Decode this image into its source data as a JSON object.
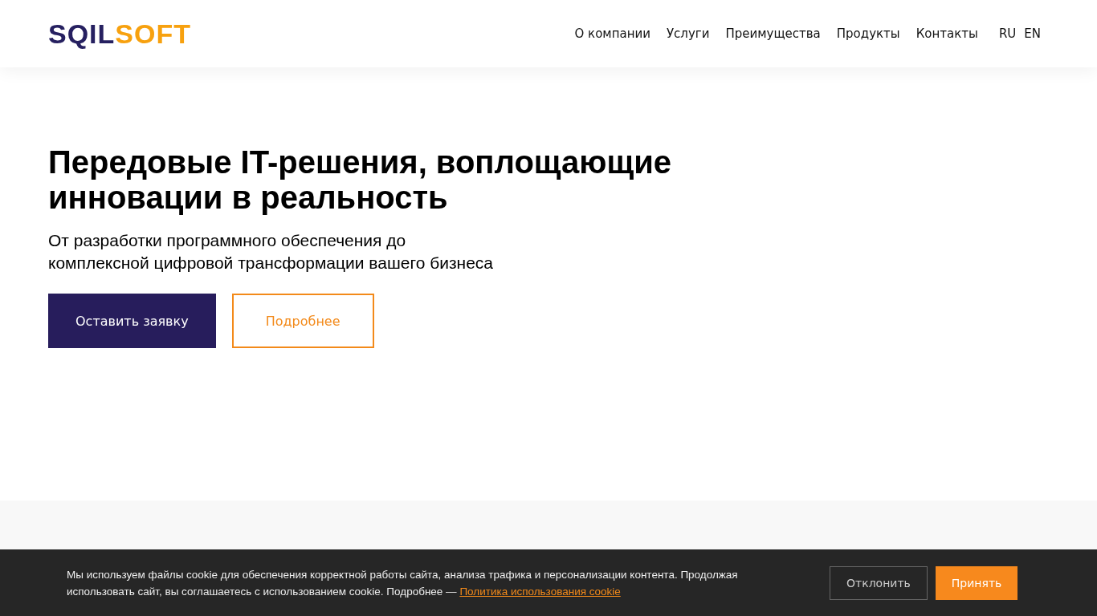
{
  "header": {
    "logo": {
      "dark_part": "SQIL",
      "accent_part": "SOFT"
    },
    "nav": [
      {
        "label": "О компании"
      },
      {
        "label": "Услуги"
      },
      {
        "label": "Преимущества"
      },
      {
        "label": "Продукты"
      },
      {
        "label": "Контакты"
      }
    ],
    "languages": [
      {
        "label": "RU"
      },
      {
        "label": "EN"
      }
    ]
  },
  "hero": {
    "title": "Передовые IT-решения, воплощающие инновации в реальность",
    "subtitle": "От разработки программного обеспечения до комплексной цифровой трансформации вашего бизнеса",
    "buttons": [
      {
        "label": "Оставить заявку",
        "kind": "primary"
      },
      {
        "label": "Подробнее",
        "kind": "outline"
      }
    ]
  },
  "cookie_banner": {
    "text": "Мы используем файлы cookie для обеспечения корректной работы сайта, анализа трафика и персонализации контента. Продолжая использовать сайт, вы соглашаетесь с использованием cookie. Подробнее —",
    "link": "Политика использования cookie",
    "buttons": [
      {
        "label": "Отклонить",
        "kind": "outline"
      },
      {
        "label": "Принять",
        "kind": "primary"
      }
    ]
  }
}
